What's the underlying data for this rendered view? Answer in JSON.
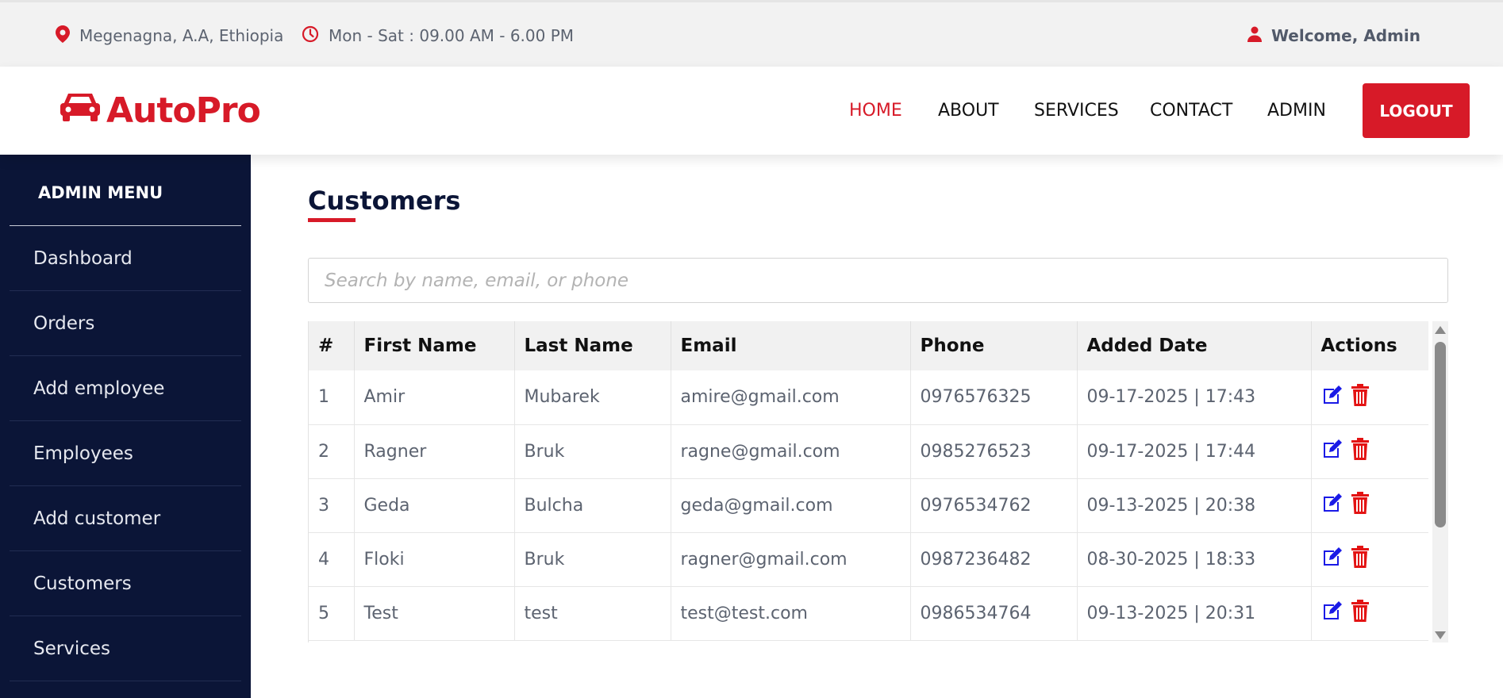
{
  "topbar": {
    "location": "Megenagna, A.A, Ethiopia",
    "hours": "Mon - Sat : 09.00 AM - 6.00 PM",
    "welcome": "Welcome, Admin"
  },
  "brand": {
    "name": "AutoPro",
    "color": "#d71a28"
  },
  "nav": {
    "items": [
      "HOME",
      "ABOUT",
      "SERVICES",
      "CONTACT",
      "ADMIN"
    ],
    "active": "HOME",
    "logout": "LOGOUT"
  },
  "sidebar": {
    "title": "ADMIN MENU",
    "items": [
      "Dashboard",
      "Orders",
      "Add employee",
      "Employees",
      "Add customer",
      "Customers",
      "Services"
    ]
  },
  "main": {
    "title": "Customers",
    "search_placeholder": "Search by name, email, or phone"
  },
  "table": {
    "headers": [
      "#",
      "First Name",
      "Last Name",
      "Email",
      "Phone",
      "Added Date",
      "Actions"
    ],
    "rows": [
      [
        "1",
        "Amir",
        "Mubarek",
        "amire@gmail.com",
        "0976576325",
        "09-17-2025 | 17:43"
      ],
      [
        "2",
        "Ragner",
        "Bruk",
        "ragne@gmail.com",
        "0985276523",
        "09-17-2025 | 17:44"
      ],
      [
        "3",
        "Geda",
        "Bulcha",
        "geda@gmail.com",
        "0976534762",
        "09-13-2025 | 20:38"
      ],
      [
        "4",
        "Floki",
        "Bruk",
        "ragner@gmail.com",
        "0987236482",
        "08-30-2025 | 18:33"
      ],
      [
        "5",
        "Test",
        "test",
        "test@test.com",
        "0986534764",
        "09-13-2025 | 20:31"
      ]
    ],
    "icons": {
      "edit": "edit-icon",
      "delete": "trash-icon"
    }
  },
  "colors": {
    "accent": "#d71a28",
    "sidebar_bg": "#0b1537",
    "edit_icon": "#1a1ae6"
  }
}
